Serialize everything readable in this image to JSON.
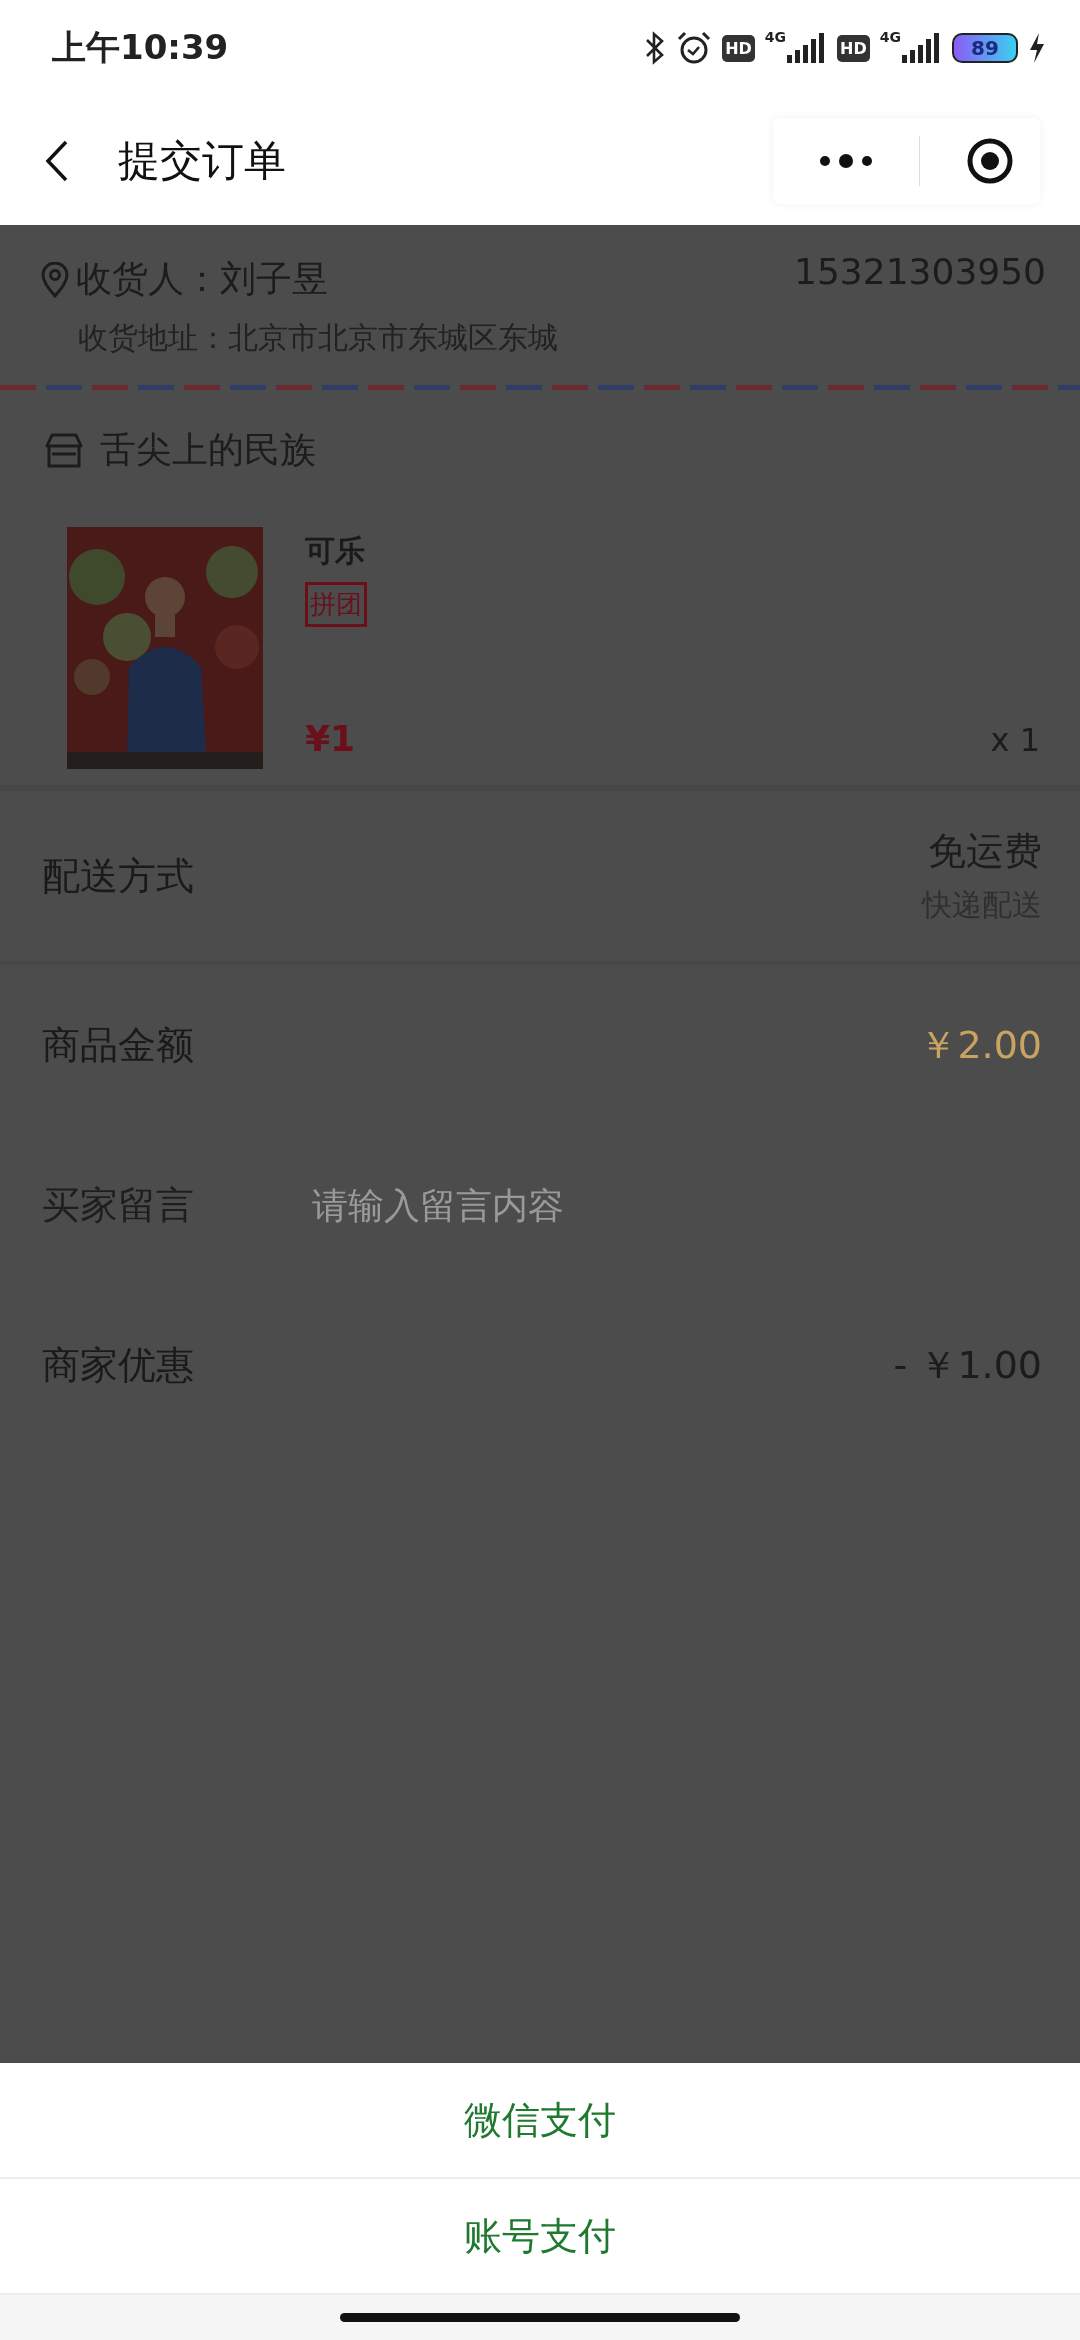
{
  "status_bar": {
    "time": "上午10:39",
    "hd_badges": [
      "HD",
      "HD"
    ],
    "networks": [
      "4G",
      "4G"
    ],
    "battery": "89"
  },
  "header": {
    "title": "提交订单"
  },
  "address": {
    "receiver": "收货人：刘子昱",
    "phone": "15321303950",
    "detail": "收货地址：北京市北京市东城区东城"
  },
  "shop": {
    "name": "舌尖上的民族"
  },
  "product": {
    "name": "可乐",
    "tag": "拼团",
    "price": "¥1",
    "quantity": "x 1"
  },
  "rows": [
    {
      "kind": "info",
      "label": "配送方式",
      "value": "免运费",
      "note": "快递配送",
      "highlighted": false
    },
    {
      "kind": "info",
      "label": "商品金额",
      "value": "￥2.00",
      "highlighted": true
    },
    {
      "kind": "input",
      "label": "买家留言",
      "placeholder": "请输入留言内容"
    },
    {
      "kind": "info",
      "label": "商家优惠",
      "value": "- ￥1.00",
      "highlighted": false
    }
  ],
  "payment_sheet": {
    "options": [
      "微信支付",
      "账号支付"
    ]
  }
}
